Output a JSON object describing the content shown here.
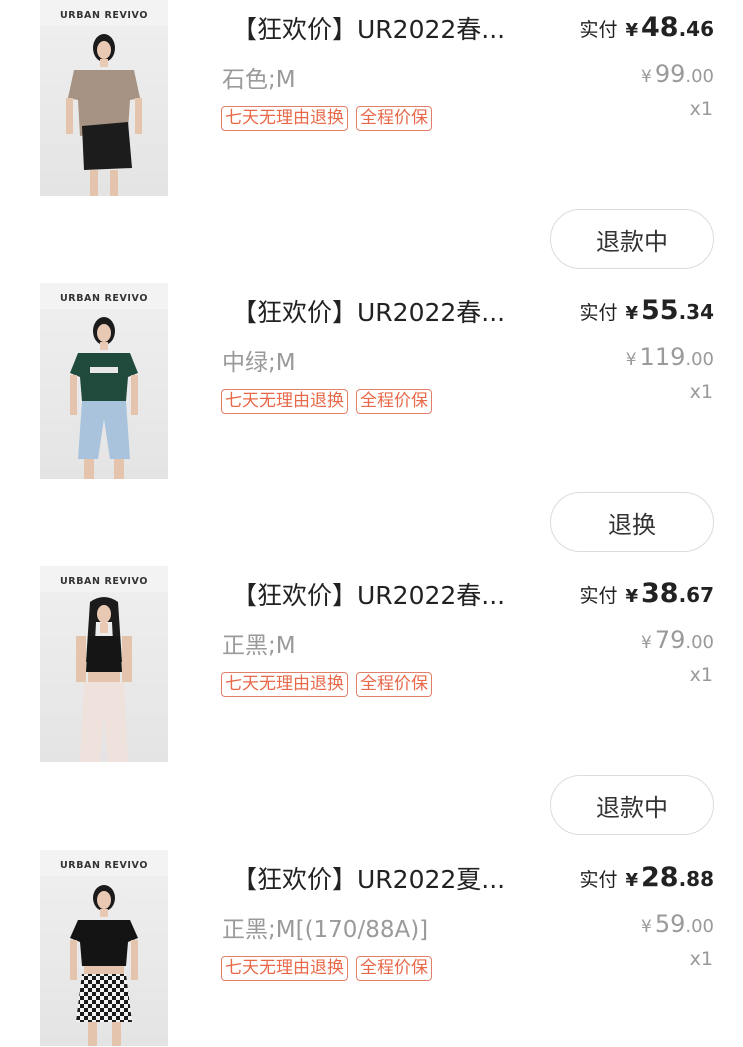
{
  "brand": "URBAN REVIVO",
  "labels": {
    "paid": "实付",
    "currency": "¥",
    "tag_return": "七天无理由退换",
    "tag_price": "全程价保"
  },
  "colors": {
    "tag": "#e8694a",
    "muted": "#9a9a9a"
  },
  "items": [
    {
      "title": "【狂欢价】UR2022春...",
      "spec": "石色;M",
      "paid_int": "48",
      "paid_dec": ".46",
      "orig_int": "99",
      "orig_dec": ".00",
      "qty": "x1",
      "action": "退款中",
      "photo_icon": "model-tshirt-skirt"
    },
    {
      "title": "【狂欢价】UR2022春...",
      "spec": "中绿;M",
      "paid_int": "55",
      "paid_dec": ".34",
      "orig_int": "119",
      "orig_dec": ".00",
      "qty": "x1",
      "action": "退换",
      "photo_icon": "model-green-tee-jeans"
    },
    {
      "title": "【狂欢价】UR2022春...",
      "spec": "正黑;M",
      "paid_int": "38",
      "paid_dec": ".67",
      "orig_int": "79",
      "orig_dec": ".00",
      "qty": "x1",
      "action": "退款中",
      "photo_icon": "model-black-tank"
    },
    {
      "title": "【狂欢价】UR2022夏...",
      "spec": "正黑;M[(170/88A)]",
      "paid_int": "28",
      "paid_dec": ".88",
      "orig_int": "59",
      "orig_dec": ".00",
      "qty": "x1",
      "photo_icon": "model-black-tee-check-skirt"
    }
  ]
}
